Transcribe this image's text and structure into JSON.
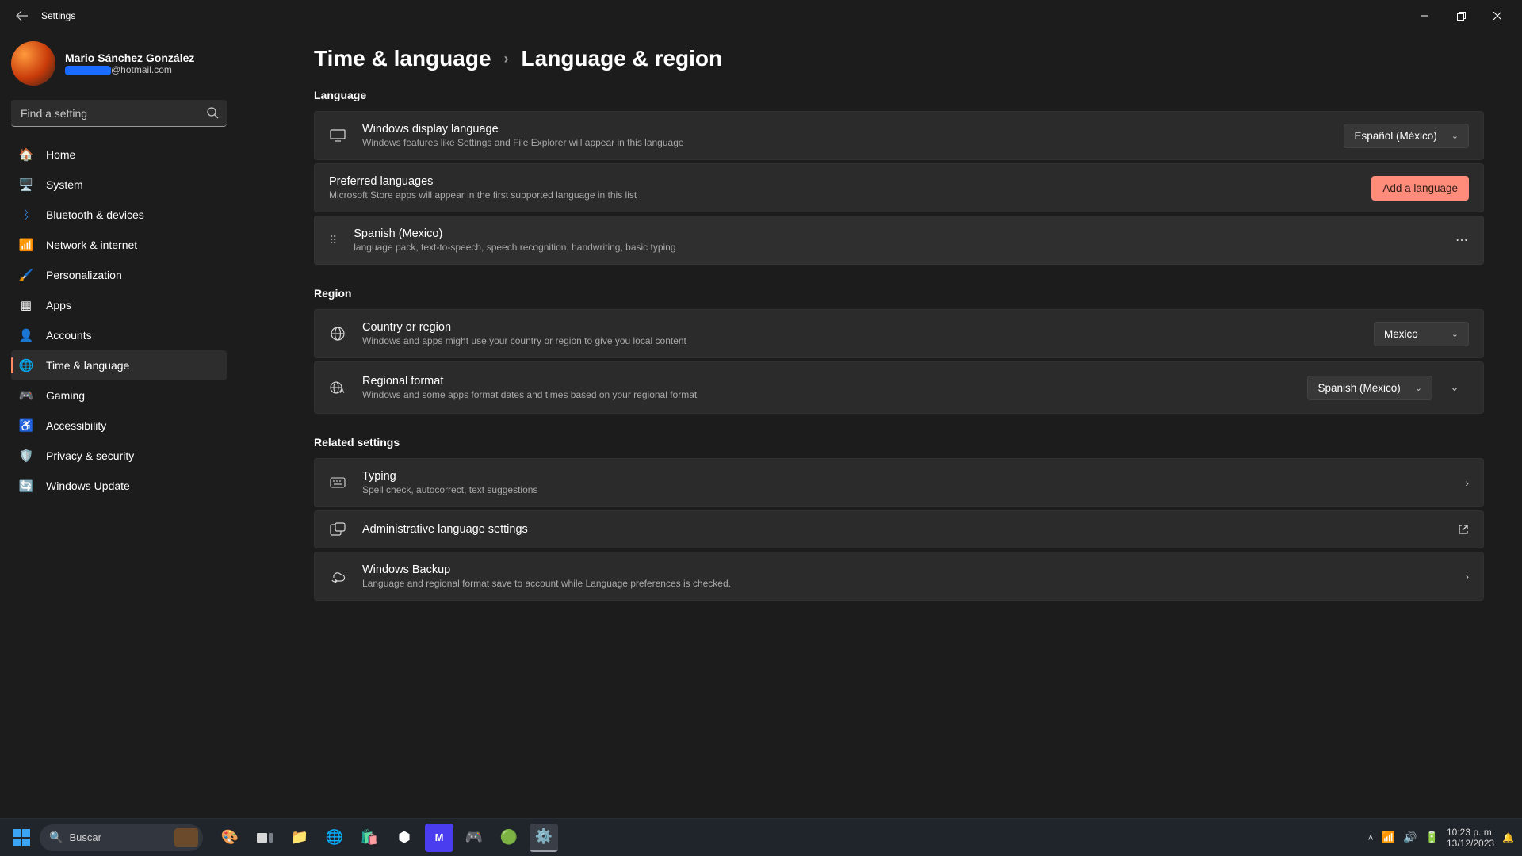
{
  "window": {
    "title": "Settings"
  },
  "profile": {
    "name": "Mario Sánchez González",
    "email_suffix": "@hotmail.com"
  },
  "search": {
    "placeholder": "Find a setting"
  },
  "sidebar": {
    "items": [
      {
        "label": "Home"
      },
      {
        "label": "System"
      },
      {
        "label": "Bluetooth & devices"
      },
      {
        "label": "Network & internet"
      },
      {
        "label": "Personalization"
      },
      {
        "label": "Apps"
      },
      {
        "label": "Accounts"
      },
      {
        "label": "Time & language"
      },
      {
        "label": "Gaming"
      },
      {
        "label": "Accessibility"
      },
      {
        "label": "Privacy & security"
      },
      {
        "label": "Windows Update"
      }
    ]
  },
  "breadcrumb": {
    "parent": "Time & language",
    "current": "Language & region"
  },
  "sections": {
    "language": {
      "title": "Language",
      "display_language": {
        "title": "Windows display language",
        "desc": "Windows features like Settings and File Explorer will appear in this language",
        "value": "Español (México)"
      },
      "preferred": {
        "title": "Preferred languages",
        "desc": "Microsoft Store apps will appear in the first supported language in this list",
        "button": "Add a language"
      },
      "lang_item": {
        "title": "Spanish (Mexico)",
        "desc": "language pack, text-to-speech, speech recognition, handwriting, basic typing"
      }
    },
    "region": {
      "title": "Region",
      "country": {
        "title": "Country or region",
        "desc": "Windows and apps might use your country or region to give you local content",
        "value": "Mexico"
      },
      "format": {
        "title": "Regional format",
        "desc": "Windows and some apps format dates and times based on your regional format",
        "value": "Spanish (Mexico)"
      }
    },
    "related": {
      "title": "Related settings",
      "typing": {
        "title": "Typing",
        "desc": "Spell check, autocorrect, text suggestions"
      },
      "admin": {
        "title": "Administrative language settings"
      },
      "backup": {
        "title": "Windows Backup",
        "desc": "Language and regional format save to account while Language preferences is checked."
      }
    }
  },
  "taskbar": {
    "search": "Buscar",
    "time": "10:23 p. m.",
    "date": "13/12/2023"
  }
}
